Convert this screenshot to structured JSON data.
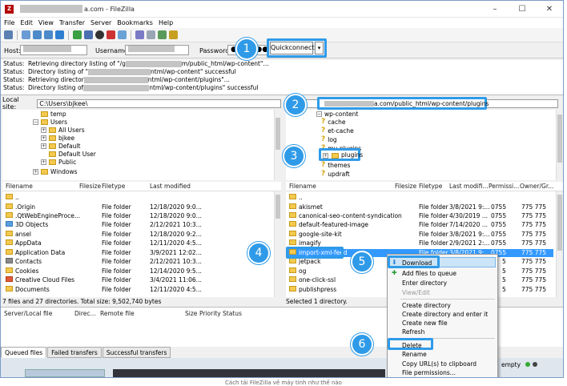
{
  "window": {
    "title": "a.com - FileZilla",
    "controls": [
      "–",
      "☐",
      "✕"
    ]
  },
  "menu": [
    "File",
    "Edit",
    "View",
    "Transfer",
    "Server",
    "Bookmarks",
    "Help"
  ],
  "quickconnect": {
    "host_label": "Host:",
    "username_label": "Username:",
    "password_label": "Password:",
    "password_value": "●●●●●●●●●",
    "button_label": "Quickconnect",
    "dropdown": "▾"
  },
  "log": [
    {
      "label": "Status:",
      "text_a": "Retrieving directory listing of \"/g",
      "text_b": "m/public_html/wp-content\"..."
    },
    {
      "label": "Status:",
      "text_a": "Directory listing of \"",
      "text_b": "ntml/wp-content\" successful"
    },
    {
      "label": "Status:",
      "text_a": "Retrieving director",
      "text_b": "ntml/wp-content/plugins\"..."
    },
    {
      "label": "Status:",
      "text_a": "Directory listing of",
      "text_b": "ntml/wp-content/plugins\" successful"
    }
  ],
  "local": {
    "site_label": "Local site:",
    "path": "C:\\Users\\bjkee\\",
    "tree": [
      "temp",
      "Users",
      "All Users",
      "bjkee",
      "Default",
      "Default User",
      "Public",
      "Windows"
    ],
    "headers": [
      "Filename",
      "Filesize",
      "Filetype",
      "Last modified"
    ],
    "files": [
      {
        "name": "..",
        "type": "",
        "modified": ""
      },
      {
        "name": ".Origin",
        "type": "File folder",
        "modified": "12/18/2020 9:0..."
      },
      {
        "name": ".QtWebEngineProce...",
        "type": "File folder",
        "modified": "12/18/2020 9:0..."
      },
      {
        "name": "3D Objects",
        "type": "File folder",
        "modified": "2/12/2021 10:3..."
      },
      {
        "name": "ansel",
        "type": "File folder",
        "modified": "12/18/2020 9:2..."
      },
      {
        "name": "AppData",
        "type": "File folder",
        "modified": "12/11/2020 4:5..."
      },
      {
        "name": "Application Data",
        "type": "File folder",
        "modified": "3/9/2021 12:02..."
      },
      {
        "name": "Contacts",
        "type": "File folder",
        "modified": "2/12/2021 10:3..."
      },
      {
        "name": "Cookies",
        "type": "File folder",
        "modified": "12/14/2020 9:5..."
      },
      {
        "name": "Creative Cloud Files",
        "type": "File folder",
        "modified": "3/4/2021 11:06..."
      },
      {
        "name": "Documents",
        "type": "File folder",
        "modified": "12/11/2020 4:5..."
      }
    ],
    "status": "7 files and 27 directories. Total size: 9,502,740 bytes"
  },
  "remote": {
    "path": "a.com/public_html/wp-content/plugins",
    "tree": [
      "wp-content",
      "cache",
      "et-cache",
      "log",
      "mu-plugins",
      "plugins",
      "themes",
      "updraft"
    ],
    "headers": [
      "Filename",
      "Filesize",
      "Filetype",
      "Last modifi...",
      "Permissi...",
      "Owner/Gr..."
    ],
    "files": [
      {
        "name": "..",
        "type": "",
        "modified": "",
        "perm": "",
        "owner": ""
      },
      {
        "name": "akismet",
        "type": "File folder",
        "modified": "3/8/2021 9:...",
        "perm": "0755",
        "owner": "775 775"
      },
      {
        "name": "canonical-seo-content-syndication",
        "type": "File folder",
        "modified": "4/30/2019 ...",
        "perm": "0755",
        "owner": "775 775"
      },
      {
        "name": "default-featured-image",
        "type": "File folder",
        "modified": "7/14/2020 ...",
        "perm": "0755",
        "owner": "775 775"
      },
      {
        "name": "google-site-kit",
        "type": "File folder",
        "modified": "3/8/2021 9:...",
        "perm": "0755",
        "owner": "775 775"
      },
      {
        "name": "imagify",
        "type": "File folder",
        "modified": "2/9/2021 2:...",
        "perm": "0755",
        "owner": "775 775"
      },
      {
        "name": "import-xml-feed",
        "type": "File folder",
        "modified": "3/8/2021 9:...",
        "perm": "0755",
        "owner": "775 775"
      },
      {
        "name": "jetpack",
        "type": "",
        "modified": "",
        "perm": "5",
        "owner": "775 775"
      },
      {
        "name": "og",
        "type": "",
        "modified": "",
        "perm": "5",
        "owner": "775 775"
      },
      {
        "name": "one-click-ssl",
        "type": "",
        "modified": "",
        "perm": "5",
        "owner": "775 775"
      },
      {
        "name": "publishpress",
        "type": "",
        "modified": "",
        "perm": "5",
        "owner": "775 775"
      }
    ],
    "status": "Selected 1 directory."
  },
  "queue": {
    "headers": [
      "Server/Local file",
      "Direc...",
      "Remote file",
      "Size",
      "Priority",
      "Status"
    ],
    "tabs": [
      "Queued files",
      "Failed transfers",
      "Successful transfers"
    ],
    "empty_label": "empty"
  },
  "context_menu": {
    "items": [
      "Download",
      "Add files to queue",
      "Enter directory",
      "View/Edit",
      "Create directory",
      "Create directory and enter it",
      "Create new file",
      "Refresh",
      "Delete",
      "Rename",
      "Copy URL(s) to clipboard",
      "File permissions..."
    ]
  },
  "callouts": [
    "1",
    "2",
    "3",
    "4",
    "5",
    "6"
  ],
  "caption": "Cách tải FileZilla về máy tính như thế nào",
  "colors": {
    "accent": "#2f9be8",
    "selection": "#3399ff"
  }
}
